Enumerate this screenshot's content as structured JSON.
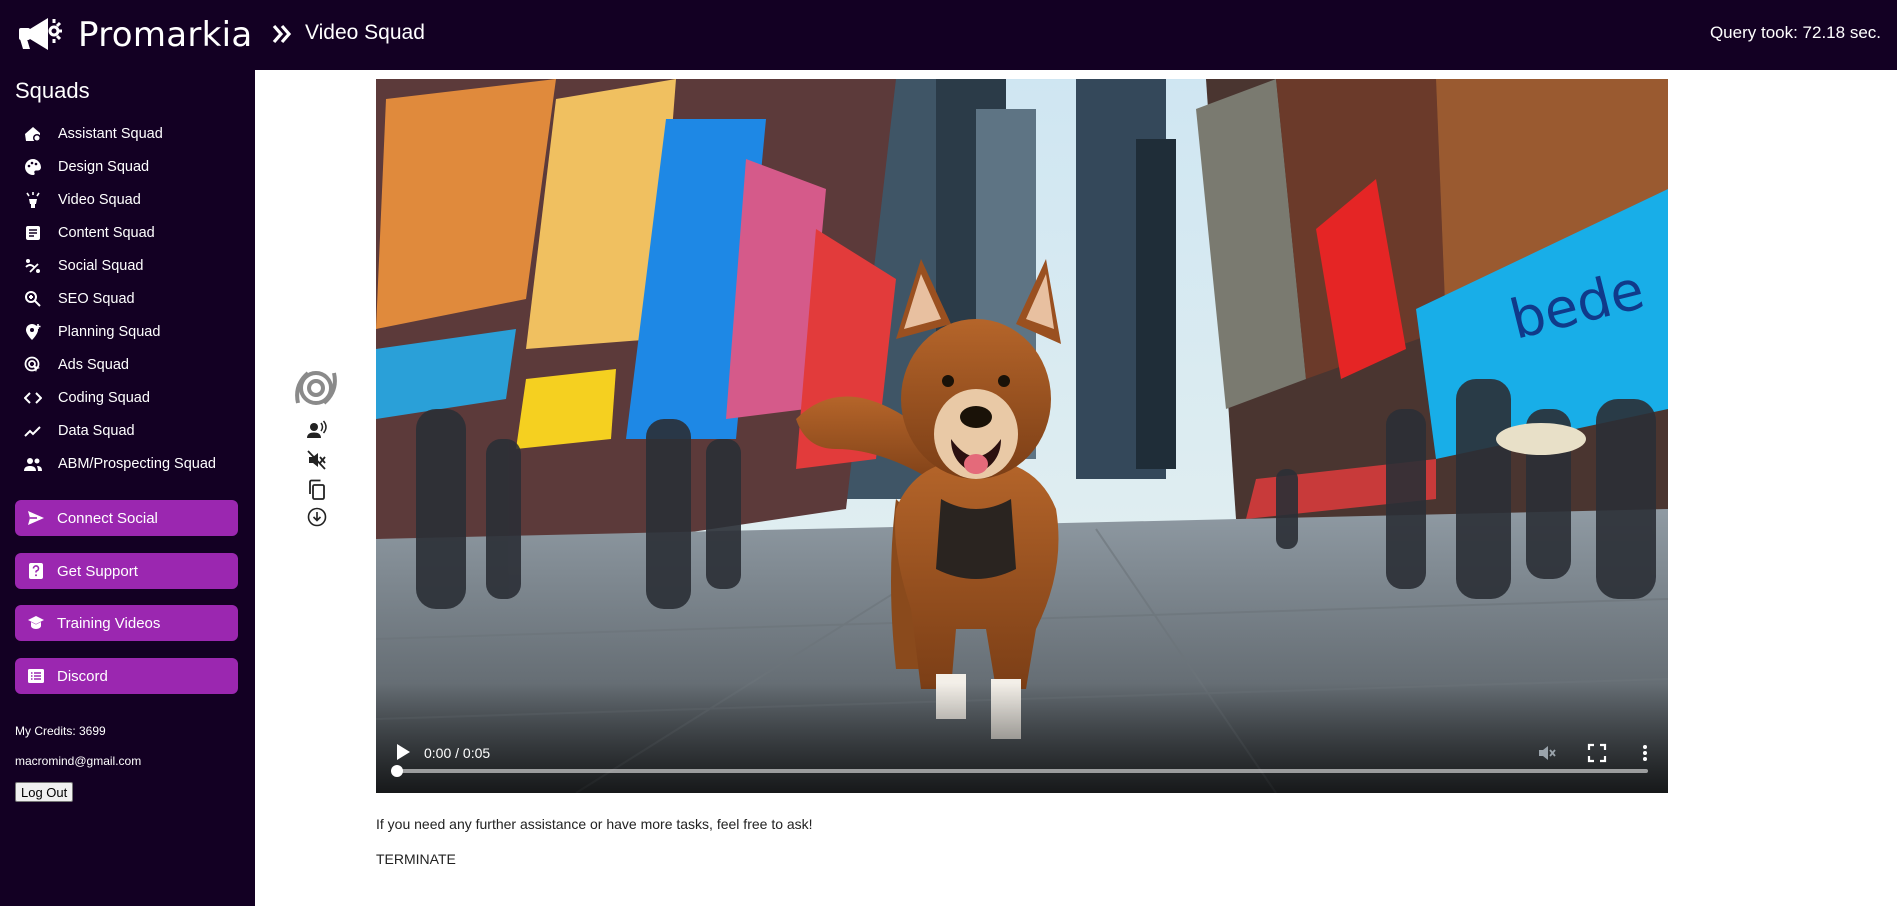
{
  "app": {
    "brand": "Promarkia",
    "breadcrumb": "Video Squad",
    "query_time": "Query took: 72.18 sec."
  },
  "sidebar": {
    "title": "Squads",
    "items": [
      {
        "label": "Assistant Squad",
        "icon": "home-gear-icon"
      },
      {
        "label": "Design Squad",
        "icon": "palette-icon"
      },
      {
        "label": "Video Squad",
        "icon": "spotlight-icon"
      },
      {
        "label": "Content Squad",
        "icon": "article-icon"
      },
      {
        "label": "Social Squad",
        "icon": "social-waves-icon"
      },
      {
        "label": "SEO Squad",
        "icon": "zoom-in-icon"
      },
      {
        "label": "Planning Squad",
        "icon": "location-add-icon"
      },
      {
        "label": "Ads Squad",
        "icon": "ads-target-icon"
      },
      {
        "label": "Coding Squad",
        "icon": "code-icon"
      },
      {
        "label": "Data Squad",
        "icon": "trending-line-icon"
      },
      {
        "label": "ABM/Prospecting Squad",
        "icon": "people-icon"
      }
    ],
    "actions": [
      {
        "label": "Connect Social",
        "icon": "send-icon"
      },
      {
        "label": "Get Support",
        "icon": "help-icon"
      },
      {
        "label": "Training Videos",
        "icon": "graduation-cap-icon"
      },
      {
        "label": "Discord",
        "icon": "list-icon"
      }
    ],
    "credits": "My Credits: 3699",
    "email": "macromind@gmail.com",
    "logout": "Log Out"
  },
  "main": {
    "video": {
      "time": "0:00 / 0:05",
      "progress": 0
    },
    "message": "If you need any further assistance or have more tasks, feel free to ask!",
    "status": "TERMINATE"
  },
  "colors": {
    "bar_bg": "#130023",
    "accent": "#9b27b0"
  }
}
